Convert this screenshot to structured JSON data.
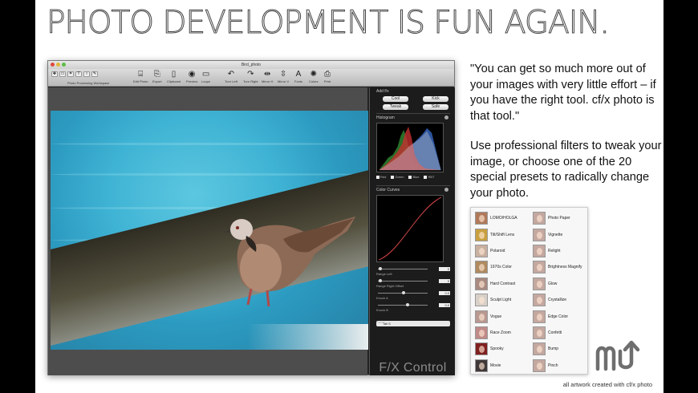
{
  "headline": "PHOTO DEVELOPMENT IS FUN AGAIN.",
  "window": {
    "title": "Bird_photo",
    "toolbar": {
      "group_label": "Photo Processing Workspace",
      "items": [
        {
          "label": "Edit Photo",
          "icon": "image-edit-icon"
        },
        {
          "label": "Export",
          "icon": "export-icon"
        },
        {
          "label": "Clipboard",
          "icon": "clipboard-icon"
        },
        {
          "label": "Preview",
          "icon": "preview-icon"
        },
        {
          "label": "Loupe",
          "icon": "loupe-icon"
        },
        {
          "label": "Turn Left",
          "icon": "rotate-left-icon"
        },
        {
          "label": "Turn Right",
          "icon": "rotate-right-icon"
        },
        {
          "label": "Mirror H",
          "icon": "mirror-horizontal-icon"
        },
        {
          "label": "Mirror V",
          "icon": "mirror-vertical-icon"
        },
        {
          "label": "Fonts",
          "icon": "fonts-icon"
        },
        {
          "label": "Colors",
          "icon": "colors-icon"
        },
        {
          "label": "Print",
          "icon": "print-icon"
        }
      ]
    },
    "panel": {
      "add_fx_label": "Add f/x",
      "fx_buttons": [
        "Cool",
        "Kick",
        "Tweak",
        "Safe"
      ],
      "histogram": {
        "title": "Histogram",
        "channels": [
          "Red",
          "Green",
          "Blue",
          "RBT"
        ]
      },
      "color_curves": {
        "title": "Color Curves",
        "sliders": [
          {
            "label": "Range Left",
            "value": "0",
            "level": 0.02
          },
          {
            "label": "Range Right Offset",
            "value": "0",
            "level": 0.02
          },
          {
            "label": "Knock A",
            "value": "0.0",
            "level": 0.5
          },
          {
            "label": "Knock B",
            "value": "0.0",
            "level": 0.58
          }
        ],
        "curve_label": "Curve",
        "curve_value": "Tall S"
      },
      "brand": "F/X Control"
    },
    "accent_colors": {
      "water": "#3fb3d4",
      "panel": "#1c1c1c"
    }
  },
  "quote": {
    "paragraph1": "\"You can get so much more out of your images with very little effort – if you have the right tool. cf/x photo is that tool.\"",
    "paragraph2": "Use professional filters to tweak your image, or choose one of the 20 special presets to radically change your photo."
  },
  "presets": {
    "left": [
      "LOMO/HOLGA",
      "Tilt/Shift Lens",
      "Polaroid",
      "1970s Color",
      "Hard Contrast",
      "Sculpt Light",
      "Vogue",
      "Race Zoom",
      "Spooky",
      "Movie"
    ],
    "right": [
      "Photo Paper",
      "Vignette",
      "Relight",
      "Brightness Magnify",
      "Glow",
      "Crystallize",
      "Edge Color",
      "Confetti",
      "Bump",
      "Pinch"
    ]
  },
  "logo_icon": "macupdate-logo-icon",
  "credit": "all artwork created with cf/x photo"
}
